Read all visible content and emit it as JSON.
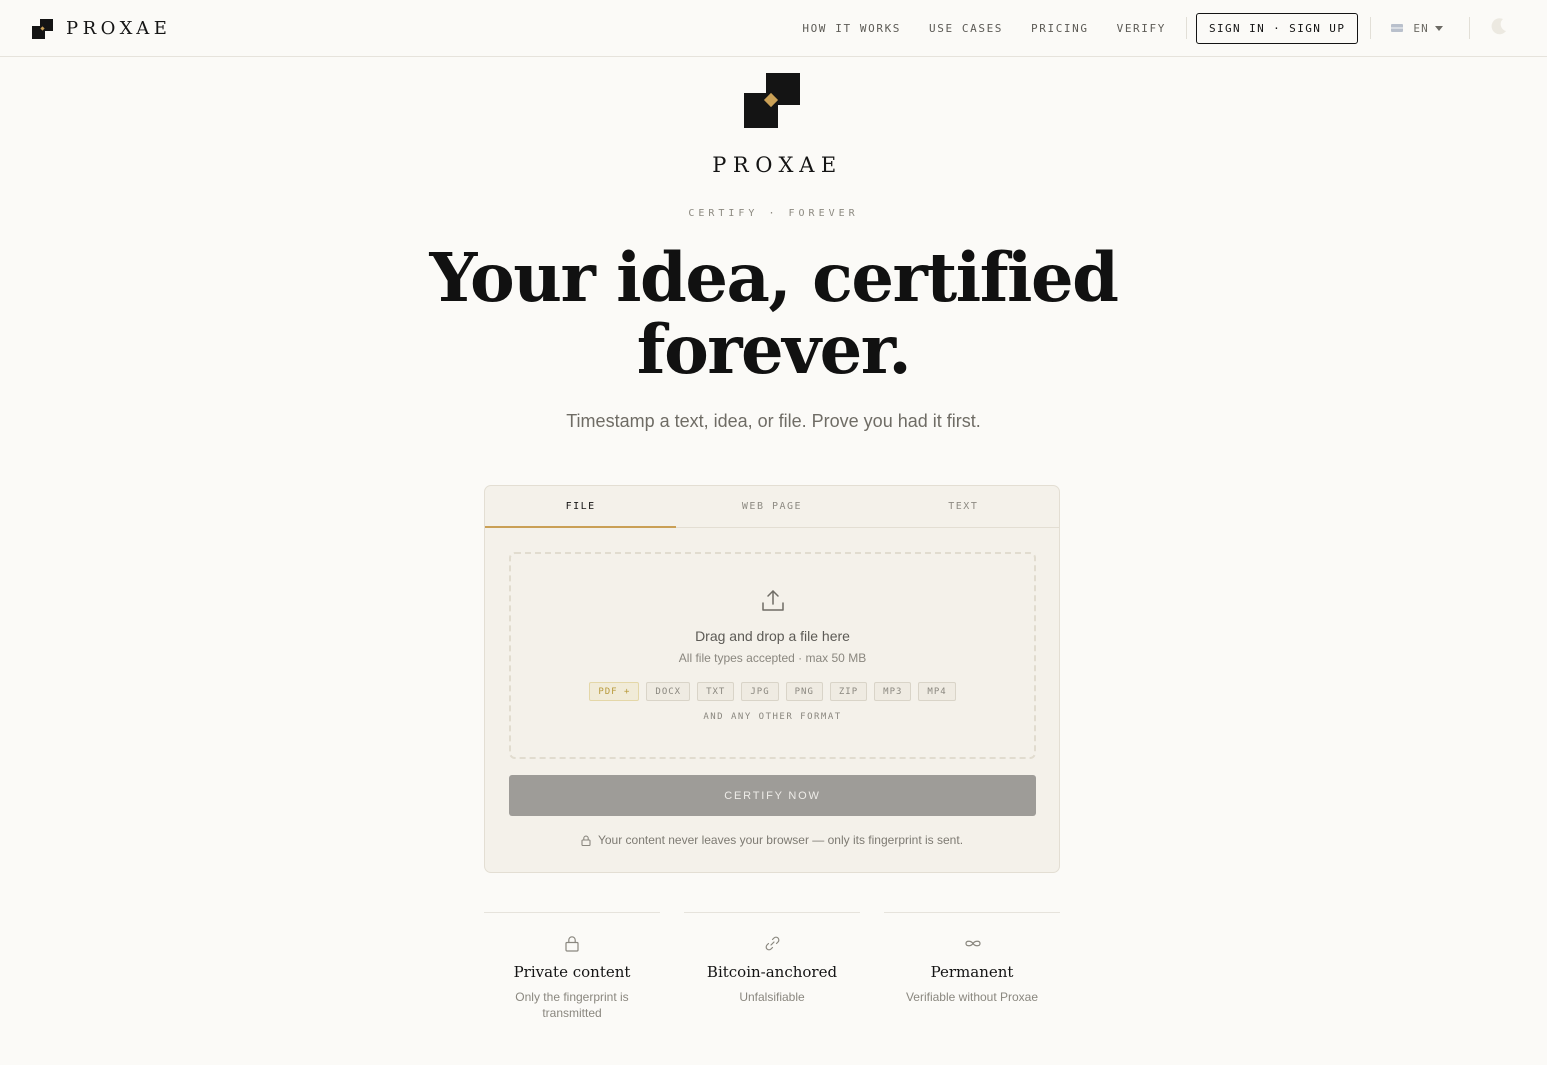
{
  "brand": {
    "name": "PROXAE"
  },
  "nav": {
    "how_it_works": "HOW IT WORKS",
    "use_cases": "USE CASES",
    "pricing": "PRICING",
    "verify": "VERIFY",
    "sign_in": "SIGN IN · SIGN UP",
    "language": "EN"
  },
  "hero": {
    "wordmark": "PROXAE",
    "tagline": "CERTIFY · FOREVER",
    "headline_line1": "Your idea, certified",
    "headline_line2": "forever.",
    "subtitle": "Timestamp a text, idea, or file. Prove you had it first."
  },
  "card": {
    "tabs": [
      {
        "label": "FILE",
        "active": true
      },
      {
        "label": "WEB PAGE",
        "active": false
      },
      {
        "label": "TEXT",
        "active": false
      }
    ],
    "dropzone": {
      "title": "Drag and drop a file here",
      "subtitle": "All file types accepted · max 50 MB",
      "formats": [
        "PDF +",
        "DOCX",
        "TXT",
        "JPG",
        "PNG",
        "ZIP",
        "MP3",
        "MP4"
      ],
      "any_format": "AND ANY OTHER FORMAT"
    },
    "certify_button": "CERTIFY NOW",
    "privacy_note": "Your content never leaves your browser — only its fingerprint is sent."
  },
  "features": [
    {
      "icon": "lock-icon",
      "title": "Private content",
      "description": "Only the fingerprint is transmitted"
    },
    {
      "icon": "link-icon",
      "title": "Bitcoin-anchored",
      "description": "Unfalsifiable"
    },
    {
      "icon": "infinity-icon",
      "title": "Permanent",
      "description": "Verifiable without Proxae"
    }
  ],
  "colors": {
    "background": "#fbfaf7",
    "card": "#f4f1ea",
    "accent_gold": "#caa056",
    "text": "#141414",
    "button_disabled": "#9e9c98"
  }
}
